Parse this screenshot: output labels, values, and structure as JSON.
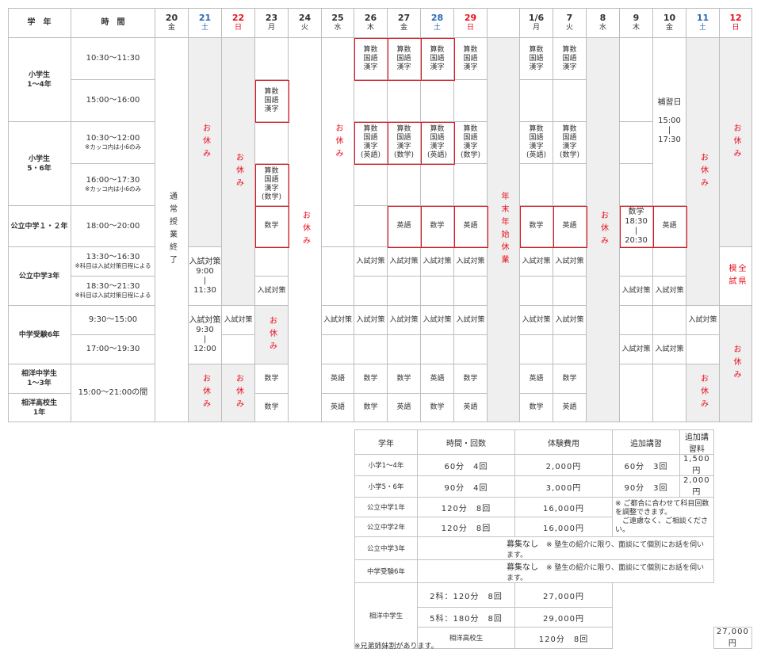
{
  "schedule": {
    "head_grade": "学　年",
    "head_time": "時　間",
    "days": [
      {
        "num": "20",
        "wd": "金",
        "color": "normal"
      },
      {
        "num": "21",
        "wd": "土",
        "color": "blue"
      },
      {
        "num": "22",
        "wd": "日",
        "color": "red"
      },
      {
        "num": "23",
        "wd": "月",
        "color": "normal"
      },
      {
        "num": "24",
        "wd": "火",
        "color": "normal"
      },
      {
        "num": "25",
        "wd": "水",
        "color": "normal"
      },
      {
        "num": "26",
        "wd": "木",
        "color": "normal"
      },
      {
        "num": "27",
        "wd": "金",
        "color": "normal"
      },
      {
        "num": "28",
        "wd": "土",
        "color": "blue"
      },
      {
        "num": "29",
        "wd": "日",
        "color": "red"
      },
      {
        "num": "",
        "wd": "",
        "color": "normal"
      },
      {
        "num": "1/6",
        "wd": "月",
        "color": "normal"
      },
      {
        "num": "7",
        "wd": "火",
        "color": "normal"
      },
      {
        "num": "8",
        "wd": "水",
        "color": "normal"
      },
      {
        "num": "9",
        "wd": "木",
        "color": "normal"
      },
      {
        "num": "10",
        "wd": "金",
        "color": "normal"
      },
      {
        "num": "11",
        "wd": "土",
        "color": "blue"
      },
      {
        "num": "12",
        "wd": "日",
        "color": "red"
      }
    ],
    "grades": [
      "小学生\n1～4年",
      "小学生\n5・6年",
      "公立中学１・２年",
      "公立中学3年",
      "中学受験6年",
      "相洋中学生\n1～3年",
      "相洋高校生\n1年"
    ],
    "times": [
      {
        "main": "10:30～11:30",
        "note": ""
      },
      {
        "main": "15:00～16:00",
        "note": ""
      },
      {
        "main": "10:30～12:00",
        "note": "※カッコ内は小6のみ"
      },
      {
        "main": "16:00～17:30",
        "note": "※カッコ内は小6のみ"
      },
      {
        "main": "18:00～20:00",
        "note": ""
      },
      {
        "main": "13:30～16:30",
        "note": "※科目は入試対策日程による"
      },
      {
        "main": "18:30～21:30",
        "note": "※科目は入試対策日程による"
      },
      {
        "main": "9:30～15:00",
        "note": ""
      },
      {
        "main": "17:00～19:30",
        "note": ""
      },
      {
        "main": "15:00～21:00の間",
        "note": ""
      }
    ],
    "labels": {
      "holiday": "お休み",
      "school_end": "通常授業終了",
      "new_year": "年末年始休業",
      "subj3": "算数\n国語\n漢字",
      "subj3_math": "算数\n国語\n漢字\n(数学)",
      "subj3_eng": "算数\n国語\n漢字\n(英語)",
      "math": "数学",
      "eng": "英語",
      "exam": "入試対策",
      "makeup": "補習日",
      "makeup_time": "15:00\n|\n17:30",
      "exam_2130": "入試対策\n9:00\n|\n11:30",
      "exam_0930": "入試対策\n9:30\n|\n12:00",
      "math_1830": "数学\n18:30\n|\n20:30",
      "mock": "全県\n模試"
    }
  },
  "price": {
    "headers": [
      "学年",
      "時間・回数",
      "体験費用",
      "追加講習",
      "追加講習料"
    ],
    "rows": [
      {
        "grade": "小学1～4年",
        "time": "60分　4回",
        "fee": "2,000円",
        "extra": "60分　3回",
        "extra_fee": "1,500円"
      },
      {
        "grade": "小学5・6年",
        "time": "90分　4回",
        "fee": "3,000円",
        "extra": "90分　3回",
        "extra_fee": "2,000円"
      },
      {
        "grade": "公立中学1年",
        "time": "120分　8回",
        "fee": "16,000円"
      },
      {
        "grade": "公立中学2年",
        "time": "120分　8回",
        "fee": "16,000円"
      }
    ],
    "note": "※ ご都合に合わせて科目回数を調整できます。\n　ご遠慮なく、ご相談ください。",
    "no_recruit_label": "募集なし",
    "no_recruit_note": "※ 塾生の紹介に限り、面談にて個別にお話を伺います。",
    "row_jh3": "公立中学3年",
    "row_exam6": "中学受験6年",
    "soyo_jh": "相洋中学生",
    "soyo_jh_opt1": "2科：120分　8回",
    "soyo_jh_fee1": "27,000円",
    "soyo_jh_opt2": "5科：180分　8回",
    "soyo_jh_fee2": "29,000円",
    "soyo_hs": "相洋高校生",
    "soyo_hs_opt": "120分　8回",
    "soyo_hs_fee": "27,000円"
  },
  "footnote": "※兄弟姉妹割があります。"
}
